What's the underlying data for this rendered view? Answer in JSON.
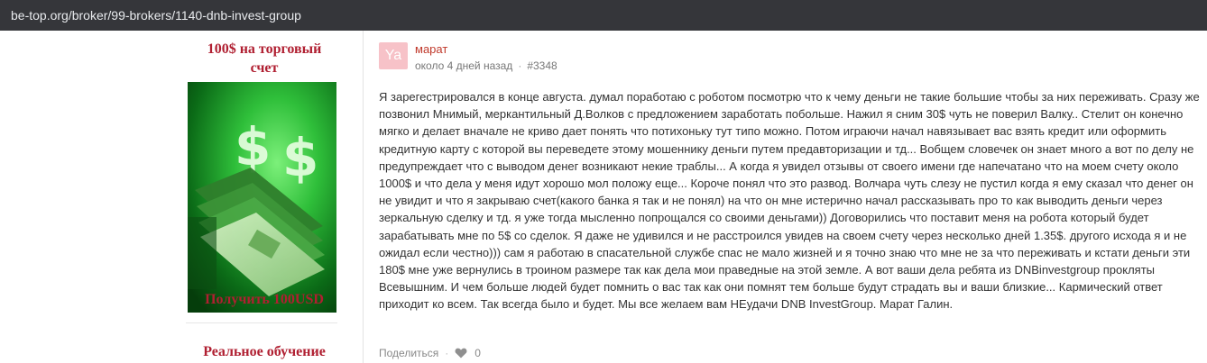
{
  "browser": {
    "url": "be-top.org/broker/99-brokers/1140-dnb-invest-group"
  },
  "sidebar": {
    "promo1_title_line1": "100$ на торговый",
    "promo1_title_line2": "счет",
    "promo1_cta": "Получить 100USD",
    "promo2_title": "Реальное обучение"
  },
  "comment": {
    "avatar_initials": "Ya",
    "author": "марат",
    "time": "около 4 дней назад",
    "id": "#3348",
    "text": "Я зарегестрировался в конце августа. думал поработаю с роботом посмотрю что к чему деньги не такие большие чтобы за них переживать. Сразу же позвонил Мнимый, меркантильный Д.Волков с предложением заработать побольше. Нажил я сним 30$ чуть не поверил Валку.. Стелит он конечно мягко и делает вначале не криво дает понять что потихоньку тут типо можно. Потом играючи начал навязывает вас взять кредит или оформить кредитную карту с которой вы переведете этому мошеннику деньги путем предавторизации и тд... Вобщем словечек он знает много а вот по делу не предупреждает что с выводом денег возникают некие траблы... А когда я увидел отзывы от своего имени где напечатано что на моем счету около 1000$ и что дела у меня идут хорошо мол положу еще... Короче понял что это развод. Волчара чуть слезу не пустил когда я ему сказал что денег он не увидит и что я закрываю счет(какого банка я так и не понял) на что он мне истерично начал рассказывать про то как выводить деньги через зеркальную сделку и тд. я уже тогда мысленно попрощался со своими деньгами)) Договорились что поставит меня на робота который будет зарабатывать мне по 5$ со сделок. Я даже не удивился и не расстроился увидев на своем счету через несколько дней 1.35$. другого исхода я и не ожидал если честно))) сам я работаю в спасательной службе спас не мало жизней и я точно знаю что мне не за что переживать и кстати деньги эти 180$ мне уже вернулись в троином размере так как дела мои праведные на этой земле. А вот ваши дела ребята из DNBinvestgroup прокляты Всевышним. И чем больше людей будет помнить о вас так как они помнят тем больше будут страдать вы и ваши близкие... Кармический ответ приходит ко всем. Так всегда было и будет. Мы все желаем вам НЕудачи DNB InvestGroup. Марат Галин.",
    "share_label": "Поделиться",
    "likes": "0"
  },
  "colors": {
    "accent": "#b01f31",
    "author": "#c0392b",
    "avatar_bg": "#f7c2c8"
  },
  "icons": [
    "heart-icon"
  ]
}
